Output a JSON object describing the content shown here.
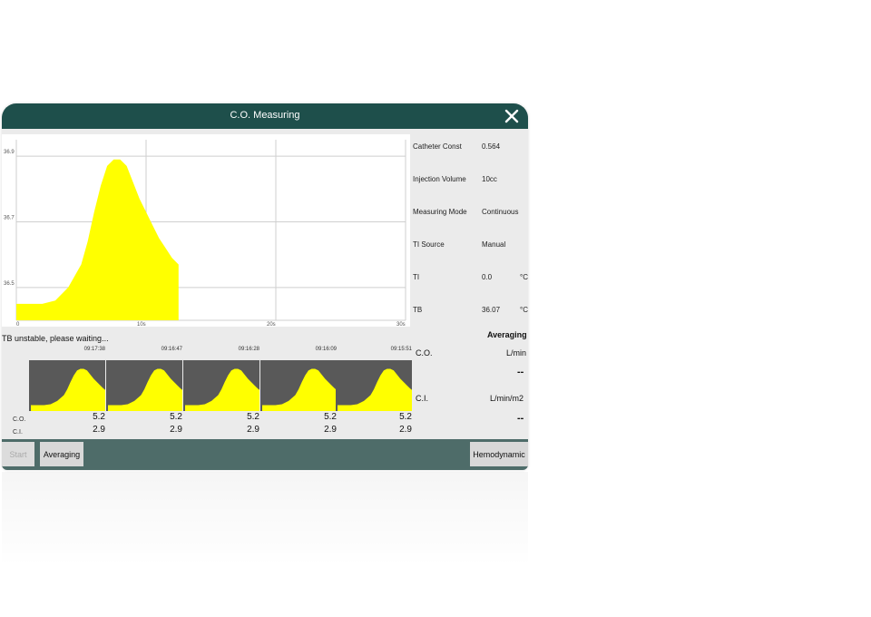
{
  "window": {
    "title": "C.O. Measuring"
  },
  "icons": {
    "close": "close-icon"
  },
  "colors": {
    "titlebar": "#1e4f4b",
    "bottombar": "#4e6c69",
    "curve": "#ffff00",
    "thumb_bg": "#595959"
  },
  "chart_data": {
    "type": "area",
    "y_ticks": [
      "36.9",
      "36.7",
      "36.5"
    ],
    "x_ticks": [
      "0",
      "10s",
      "20s",
      "30s"
    ],
    "grid": true,
    "series": [
      {
        "x": [
          0,
          1,
          2,
          3,
          4,
          5,
          5.5,
          6,
          6.5,
          7,
          7.5,
          8,
          8.5,
          9,
          9.5,
          10,
          10.5,
          11,
          11.5,
          12,
          12.5
        ],
        "values": [
          36.45,
          36.45,
          36.45,
          36.46,
          36.5,
          36.57,
          36.64,
          36.73,
          36.81,
          36.87,
          36.89,
          36.89,
          36.87,
          36.82,
          36.77,
          36.73,
          36.69,
          36.65,
          36.62,
          36.59,
          36.57
        ]
      }
    ]
  },
  "params": [
    {
      "label": "Catheter Const",
      "value": "0.564",
      "unit": ""
    },
    {
      "label": "Injection Volume",
      "value": "10cc",
      "unit": ""
    },
    {
      "label": "Measuring Mode",
      "value": "Continuous",
      "unit": ""
    },
    {
      "label": "TI Source",
      "value": "Manual",
      "unit": ""
    },
    {
      "label": "TI",
      "value": "0.0",
      "unit": "°C"
    },
    {
      "label": "TB",
      "value": "36.07",
      "unit": "°C"
    }
  ],
  "status": "TB unstable, please waiting...",
  "averaging": {
    "heading": "Averaging",
    "co_label": "C.O.",
    "co_unit": "L/min",
    "co_value": "--",
    "ci_label": "C.I.",
    "ci_unit": "L/min/m2",
    "ci_value": "--"
  },
  "history": {
    "co_label": "C.O.",
    "ci_label": "C.I.",
    "items": [
      {
        "time": "09:17:38",
        "co": "5.2",
        "ci": "2.9"
      },
      {
        "time": "09:16:47",
        "co": "5.2",
        "ci": "2.9"
      },
      {
        "time": "09:16:28",
        "co": "5.2",
        "ci": "2.9"
      },
      {
        "time": "09:16:09",
        "co": "5.2",
        "ci": "2.9"
      },
      {
        "time": "09:15:51",
        "co": "5.2",
        "ci": "2.9"
      }
    ]
  },
  "buttons": {
    "start": "Start",
    "averaging": "Averaging",
    "hemodynamic": "Hemodynamic"
  }
}
